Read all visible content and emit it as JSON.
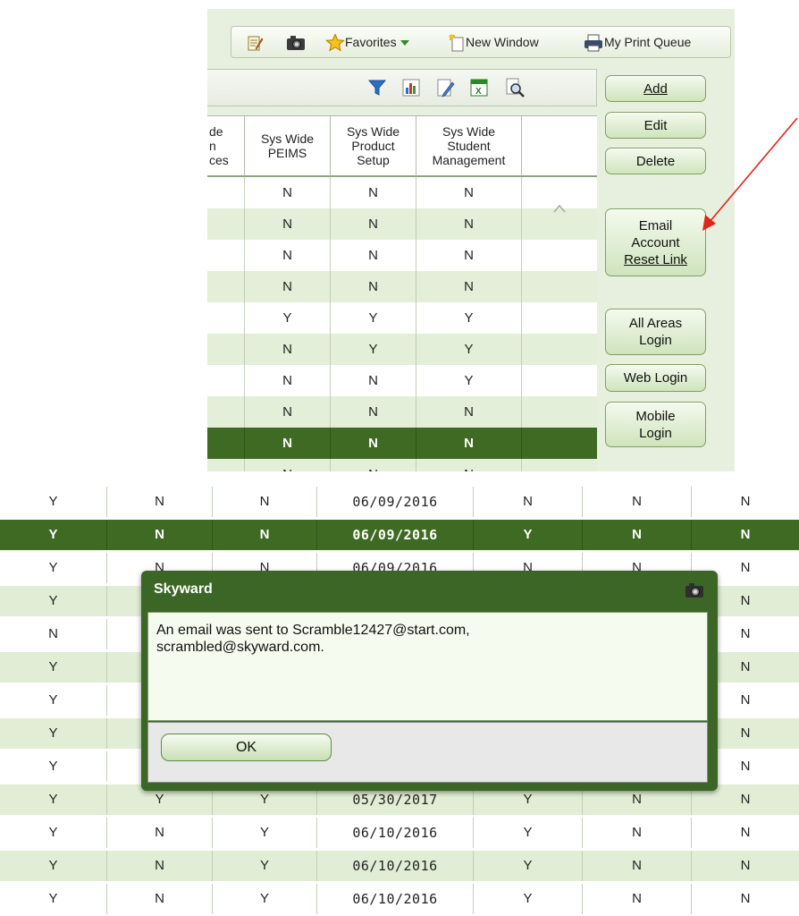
{
  "favorites_bar": {
    "items": [
      {
        "label": "",
        "icon": "edit-note-icon"
      },
      {
        "label": "",
        "icon": "camera-icon"
      },
      {
        "label": "Favorites",
        "icon": "star-icon",
        "dropdown": true
      },
      {
        "label": "New Window",
        "icon": "new-window-icon"
      },
      {
        "label": "My Print Queue",
        "icon": "printer-icon"
      }
    ]
  },
  "grid_toolbar": {
    "icons": [
      "filter-icon",
      "chart-icon",
      "edit-icon",
      "excel-export-icon",
      "print-preview-icon"
    ]
  },
  "top_grid": {
    "columns": [
      {
        "label": "de\nn\nces"
      },
      {
        "label": "Sys Wide\nPEIMS"
      },
      {
        "label": "Sys Wide\nProduct\nSetup"
      },
      {
        "label": "Sys Wide\nStudent\nManagement"
      }
    ],
    "rows": [
      [
        "N",
        "N",
        "N"
      ],
      [
        "N",
        "N",
        "N"
      ],
      [
        "N",
        "N",
        "N"
      ],
      [
        "N",
        "N",
        "N"
      ],
      [
        "Y",
        "Y",
        "Y"
      ],
      [
        "N",
        "Y",
        "Y"
      ],
      [
        "N",
        "N",
        "Y"
      ],
      [
        "N",
        "N",
        "N"
      ],
      [
        "N",
        "N",
        "N"
      ],
      [
        "N",
        "N",
        "N"
      ]
    ],
    "selected_row": 8
  },
  "side_buttons": {
    "add": "Add",
    "edit": "Edit",
    "delete": "Delete",
    "email_reset": [
      "Email",
      "Account",
      "Reset Link"
    ],
    "all_areas": [
      "All Areas",
      "Login"
    ],
    "web_login": "Web Login",
    "mobile_login": [
      "Mobile",
      "Login"
    ]
  },
  "annotation": {
    "arrow_color": "#e3241b"
  },
  "bottom_grid": {
    "rows": [
      [
        "Y",
        "N",
        "N",
        "06/09/2016",
        "N",
        "N",
        "N"
      ],
      [
        "Y",
        "N",
        "N",
        "06/09/2016",
        "Y",
        "N",
        "N"
      ],
      [
        "Y",
        "N",
        "N",
        "06/09/2016",
        "N",
        "N",
        "N"
      ],
      [
        "Y",
        "",
        "",
        "",
        "",
        "",
        "N"
      ],
      [
        "N",
        "",
        "",
        "",
        "",
        "",
        "N"
      ],
      [
        "Y",
        "",
        "",
        "",
        "",
        "",
        "N"
      ],
      [
        "Y",
        "",
        "",
        "",
        "",
        "",
        "N"
      ],
      [
        "Y",
        "",
        "",
        "",
        "",
        "",
        "N"
      ],
      [
        "Y",
        "",
        "",
        "",
        "",
        "",
        "N"
      ],
      [
        "Y",
        "Y",
        "Y",
        "05/30/2017",
        "Y",
        "N",
        "N"
      ],
      [
        "Y",
        "N",
        "Y",
        "06/10/2016",
        "Y",
        "N",
        "N"
      ],
      [
        "Y",
        "N",
        "Y",
        "06/10/2016",
        "Y",
        "N",
        "N"
      ],
      [
        "Y",
        "N",
        "Y",
        "06/10/2016",
        "Y",
        "N",
        "N"
      ]
    ],
    "selected_row": 1
  },
  "dialog": {
    "title": "Skyward",
    "message_line1": "An email was sent to Scramble12427@start.com,",
    "message_line2": "scrambled@skyward.com.",
    "ok_label": "OK",
    "title_icon": "camera-icon"
  },
  "colors": {
    "accent_green": "#3e6a23",
    "alt_row": "#e1eed5"
  }
}
